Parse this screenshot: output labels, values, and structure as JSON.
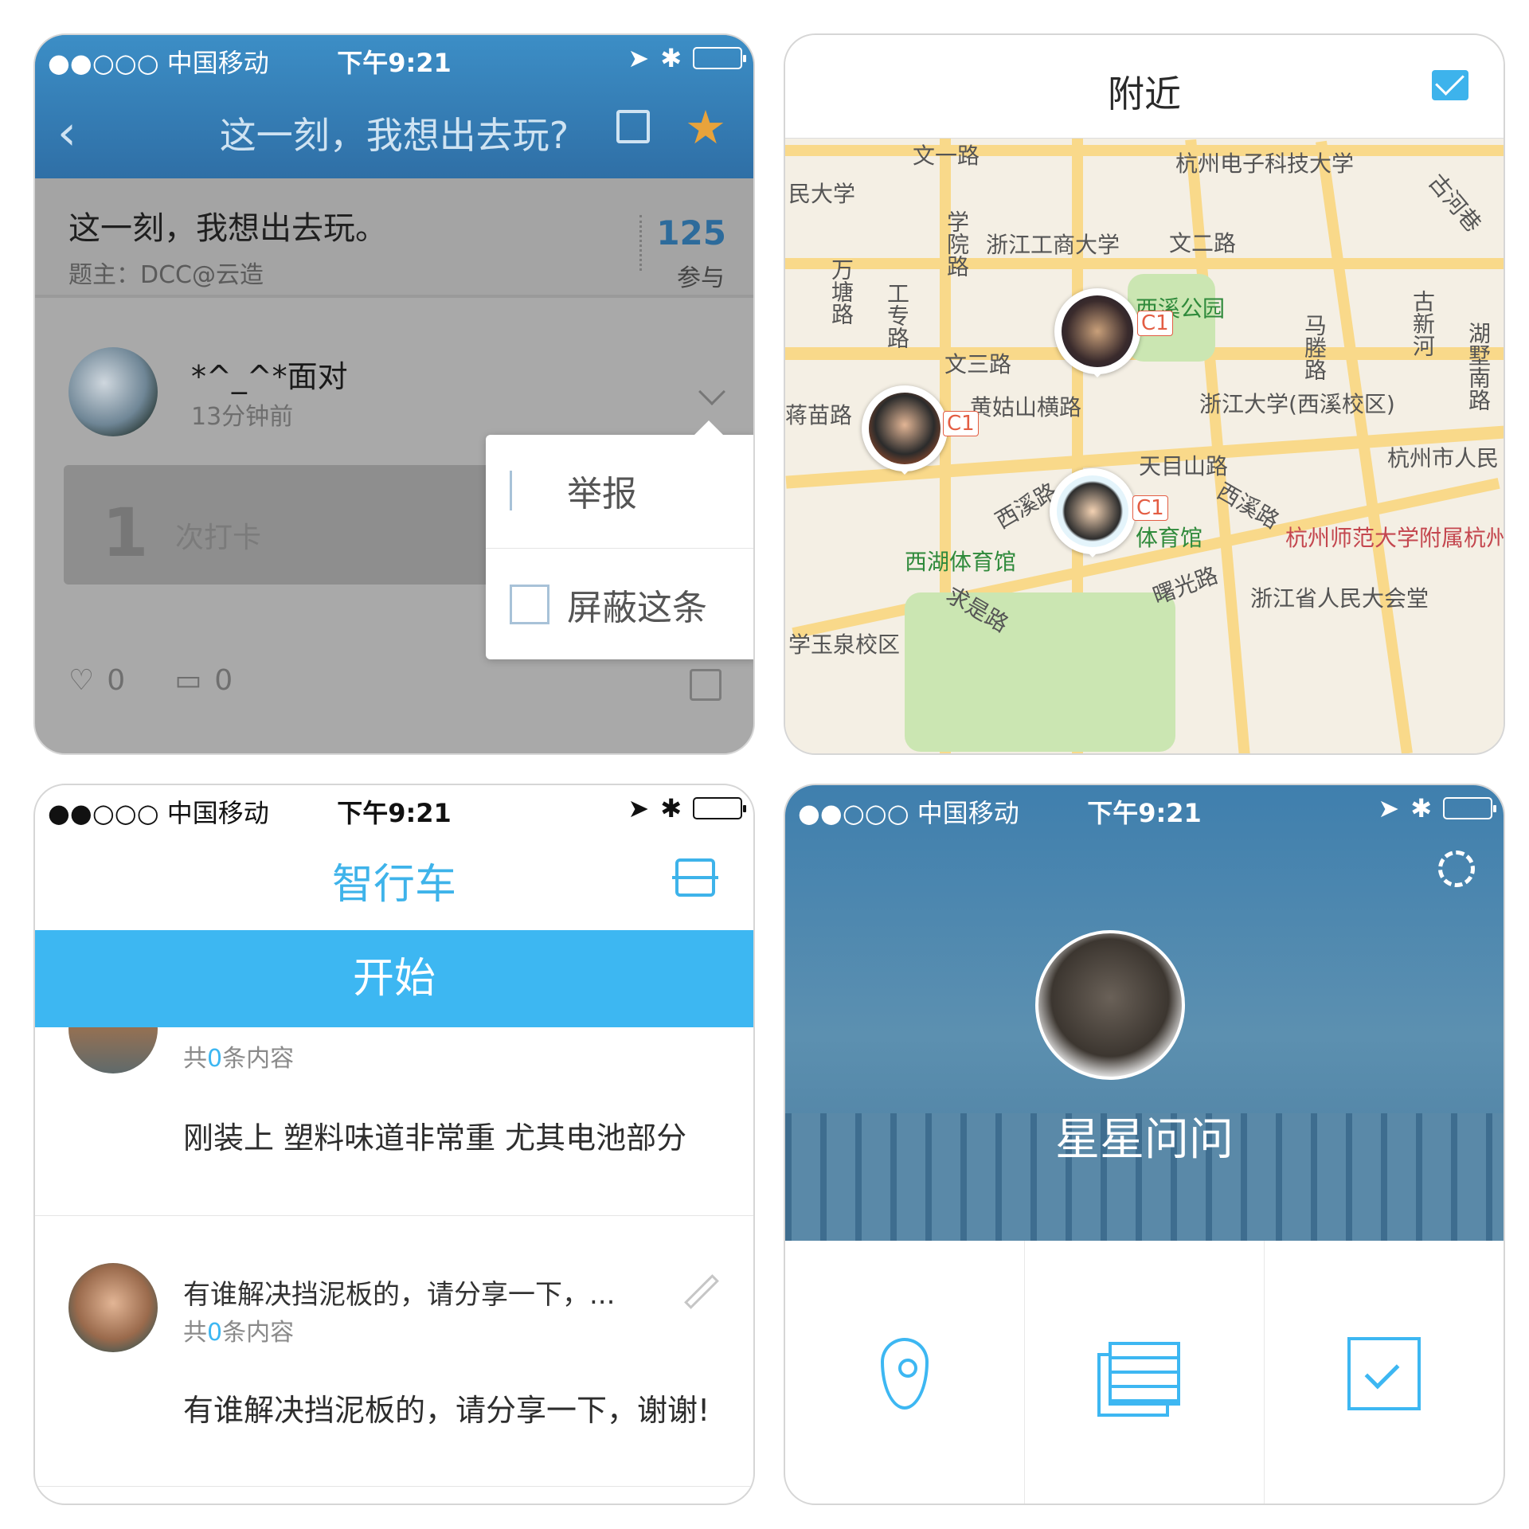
{
  "status": {
    "carrier": "●●○○○ 中国移动",
    "time": "下午9:21"
  },
  "p1": {
    "title": "这一刻，我想出去玩?",
    "topic": "这一刻，我想出去玩。",
    "owner": "题主：DCC@云造",
    "count": "125",
    "count_label": "参与",
    "user": "*^_^*面对",
    "ago": "13分钟前",
    "card_num": "1",
    "card_label": "次打卡",
    "likes": "0",
    "comments": "0",
    "menu": {
      "report": "举报",
      "hide": "屏蔽这条"
    }
  },
  "p2": {
    "title": "附近",
    "labels": {
      "hdu": "杭州电子科技大学",
      "wenyi": "文一路",
      "minda": "民大学",
      "zjgs": "浙江工商大学",
      "wener": "文二路",
      "xueyuan": "学院路",
      "wantang": "万塘路",
      "gongzhuan": "工专路",
      "xixi_park": "西溪公园",
      "wensan": "文三路",
      "huanggu": "黄姑山横路",
      "zju": "浙江大学(西溪校区)",
      "mamiao": "蒋苗路",
      "tianmu": "天目山路",
      "xixi_rd": "西溪路",
      "xixi_rd2": "西溪路",
      "hz_people": "杭州市人民",
      "stadium": "西湖体育馆",
      "tiyuguan": "体育馆",
      "hznu": "杭州师范大学附属杭州",
      "shuguang": "曙光路",
      "qiushi": "求是路",
      "assembly": "浙江省人民大会堂",
      "yuquan": "学玉泉校区",
      "guxin": "古新河",
      "hushu": "湖墅南路",
      "mateng": "马塍路",
      "guhe": "古河巷"
    },
    "badge": "C1"
  },
  "p3": {
    "title": "智行车",
    "start": "开始",
    "count_prefix": "共",
    "count_num": "0",
    "count_suffix": "条内容",
    "body1": "刚装上 塑料味道非常重 尤其电池部分",
    "q2": "有谁解决挡泥板的，请分享一下，...",
    "body2": "有谁解决挡泥板的，请分享一下，谢谢!"
  },
  "p4": {
    "name": "星星问问"
  }
}
